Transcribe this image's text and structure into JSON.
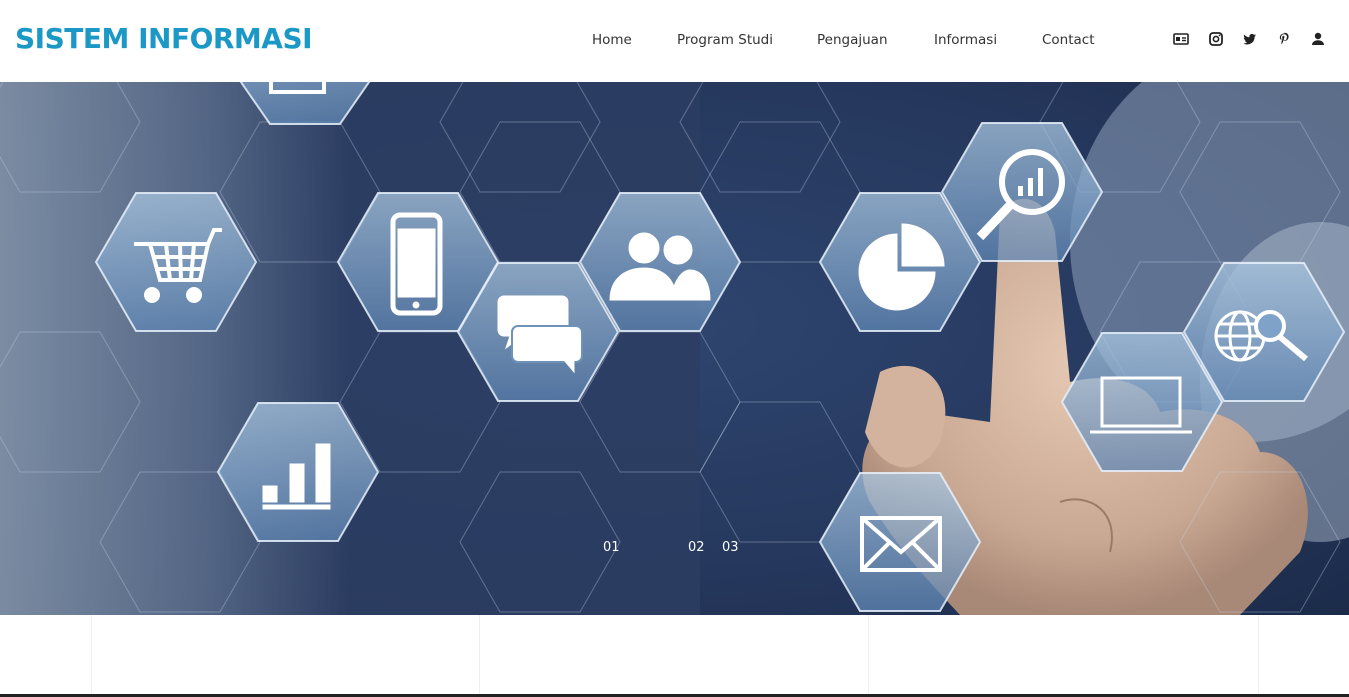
{
  "brand": {
    "name": "SISTEM INFORMASI",
    "color": "#1b98c5"
  },
  "nav": {
    "items": [
      {
        "label": "Home"
      },
      {
        "label": "Program Studi"
      },
      {
        "label": "Pengajuan"
      },
      {
        "label": "Informasi"
      },
      {
        "label": "Contact"
      }
    ]
  },
  "social": {
    "icons": [
      "id-card-icon",
      "instagram-icon",
      "twitter-icon",
      "pinterest-icon",
      "user-icon"
    ]
  },
  "hero": {
    "slides": [
      "01",
      "02",
      "03"
    ],
    "active_slide": "01",
    "icons": [
      "shopping-cart-icon",
      "smartphone-icon",
      "chat-icon",
      "users-icon",
      "pie-chart-icon",
      "search-chart-icon",
      "globe-search-icon",
      "laptop-icon",
      "bar-chart-icon",
      "envelope-icon",
      "monitor-icon"
    ]
  }
}
